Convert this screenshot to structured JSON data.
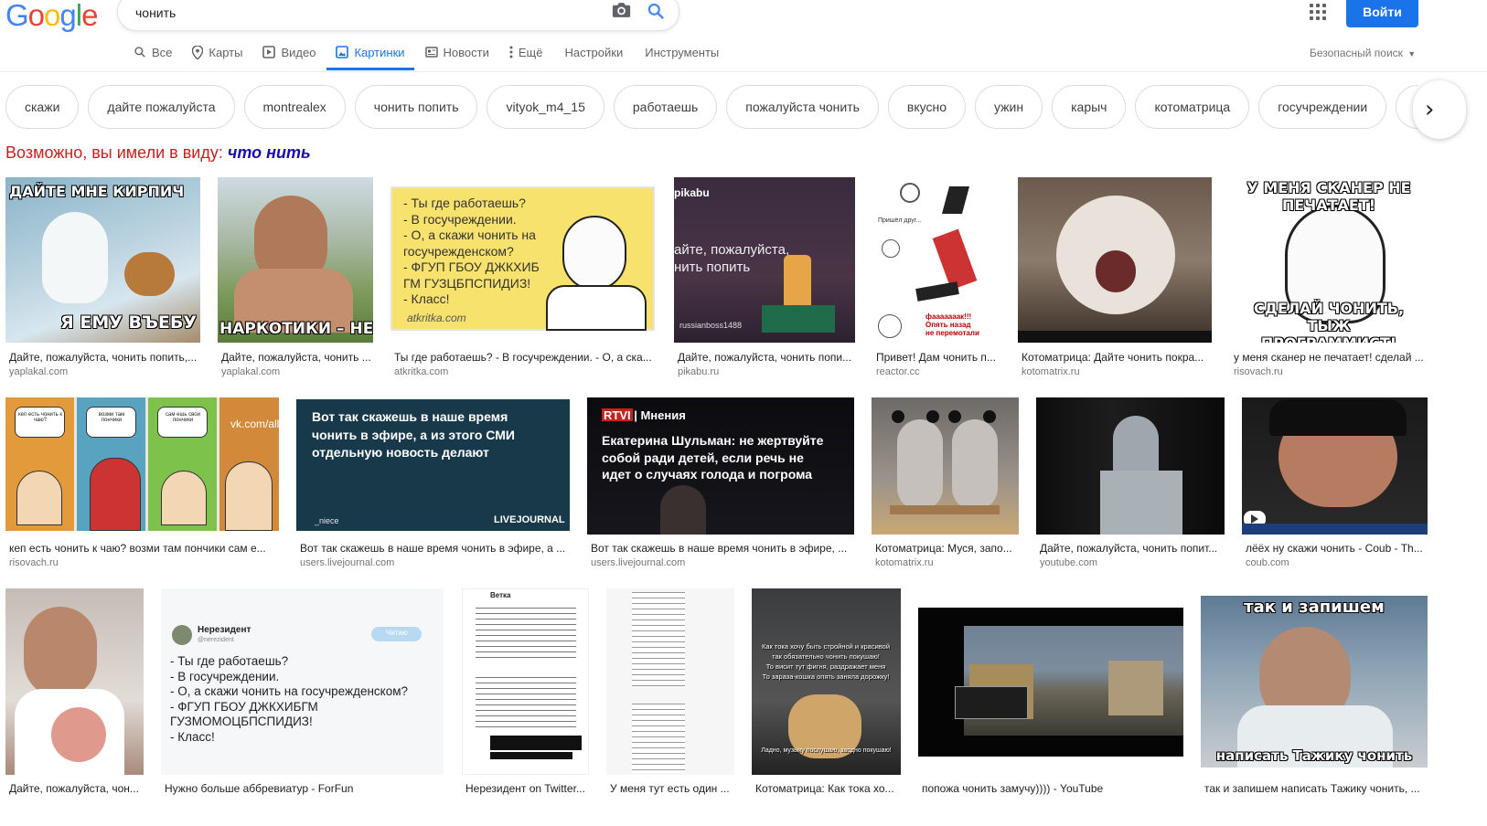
{
  "header": {
    "logo_letters": [
      "G",
      "o",
      "o",
      "g",
      "l",
      "e"
    ],
    "logo_colors": [
      "#4285f4",
      "#ea4335",
      "#fbbc05",
      "#4285f4",
      "#34a853",
      "#ea4335"
    ],
    "query": "чонить",
    "signin_label": "Войти"
  },
  "tabs": [
    {
      "label": "Все",
      "icon": "search-icon",
      "active": false
    },
    {
      "label": "Карты",
      "icon": "map-pin-icon",
      "active": false
    },
    {
      "label": "Видео",
      "icon": "video-icon",
      "active": false
    },
    {
      "label": "Картинки",
      "icon": "image-icon",
      "active": true
    },
    {
      "label": "Новости",
      "icon": "news-icon",
      "active": false
    },
    {
      "label": "Ещё",
      "icon": "more-vert-icon",
      "active": false
    }
  ],
  "tools": {
    "settings": "Настройки",
    "tools": "Инструменты"
  },
  "safe_search": "Безопасный поиск",
  "chips": [
    "скажи",
    "дайте пожалуйста",
    "montrealex",
    "чонить попить",
    "vityok_m4_15",
    "работаешь",
    "пожалуйста чонить",
    "вкусно",
    "ужин",
    "карыч",
    "котоматрица",
    "госучреждении",
    "скажешь"
  ],
  "did_you_mean": {
    "prefix": "Возможно, вы имели в виду:",
    "suggestion": "что нить"
  },
  "results": [
    {
      "caption": "Дайте, пожалуйста, чонить попить,...",
      "source": "yaplakal.com",
      "top_text": "ДАЙТЕ МНЕ КИРПИЧ",
      "bottom_text": "Я ЕМУ ВЪЕБУ"
    },
    {
      "caption": "Дайте, пожалуйста, чонить ...",
      "source": "yaplakal.com",
      "bottom_text": "НАРКОТИКИ – НЕ МОЯ Т"
    },
    {
      "caption": "Ты где работаешь? - В госучреждении. - О, а ска...",
      "source": "atkritka.com",
      "card_text": "- Ты где работаешь?\n- В госучреждении.\n- О, а скажи чонить на\nгосучрежденском?\n- ФГУП ГБОУ ДЖКХИБ\nГМ ГУЗЦБПСПИДИЗ!\n- Класс!",
      "brand": "atkritka.com"
    },
    {
      "caption": "Дайте, пожалуйста, чонить попи...",
      "source": "pikabu.ru",
      "header_text": "pikabu",
      "card_text": "айте, пожалуйста,\nнить попить",
      "footer_text": "russianboss1488"
    },
    {
      "caption": "Привет! Дам чонить п...",
      "source": "reactor.cc",
      "top_text": "Пришёл друг...",
      "bottom_text": "фааааааак!!!\nОпять назад\nне перемотали"
    },
    {
      "caption": "Котоматрица: Дайте чонить покра...",
      "source": "kotomatrix.ru"
    },
    {
      "caption": "у меня сканер не печатает! сделай ...",
      "source": "risovach.ru",
      "top_text": "У МЕНЯ СКАНЕР НЕ\nПЕЧАТАЕТ!",
      "bottom_text": "СДЕЛАЙ ЧОНИТЬ, ТЫЖ\nПРОГРАММИСТ!"
    },
    {
      "caption": "кеп есть чонить к чаю? возми там пончики сам е...",
      "source": "risovach.ru",
      "panel_texts": [
        "кеп есть чонить к чаю?",
        "возми там пончики",
        "сам ешь свои пончики"
      ],
      "brand": "vk.com/all"
    },
    {
      "caption": "Вот так скажешь в наше время чонить в эфире, а ...",
      "source": "users.livejournal.com",
      "card_text": "Вот так скажешь в наше время\nчонить в эфире, а из этого СМИ\nотдельную новость делают",
      "footer_text": "_niece",
      "brand": "LIVEJOURNAL"
    },
    {
      "caption": "Вот так скажешь в наше время чонить в эфире, ...",
      "source": "users.livejournal.com",
      "header_text": "RTVI | Мнения",
      "card_text": "Екатерина Шульман: не жертвуйте\nсобой ради детей, если речь не\nидет о случаях голода и погрома"
    },
    {
      "caption": "Котоматрица: Муся, запо...",
      "source": "kotomatrix.ru"
    },
    {
      "caption": "Дайте, пожалуйста, чонить попит...",
      "source": "youtube.com"
    },
    {
      "caption": "лёёх ну скажи чонить - Coub - Th...",
      "source": "coub.com"
    },
    {
      "caption": "Дайте, пожалуйста, чон...",
      "source": "yaplakal.com"
    },
    {
      "caption": "Нужно больше аббревиатур - ForFun",
      "source": "",
      "header_text": "Нерезидент",
      "handle": "@nerezident",
      "card_text": "- Ты где работаешь?\n- В госучреждении.\n- О, а скажи чонить на госучрежденском?\n- ФГУП ГБОУ ДЖКХИБГМ\nГУЗМОМОЦБПСПИДИЗ!\n- Класс!",
      "brand": "Читаю"
    },
    {
      "caption": "Нерезидент on Twitter...",
      "source": "",
      "header_text": "Ветка"
    },
    {
      "caption": "У меня тут есть один ...",
      "source": ""
    },
    {
      "caption": "Котоматрица: Как тока хо...",
      "source": "",
      "card_text": "Как тока хочу быть стройной и красивой\nтак обязательно чонить покушаю!\nТо висит тут фигня, раздражает меня\nТо зараза-кошка опять заняла дорожку!",
      "footer_text": "Ладно, музыку послушаю, заодно покушаю!"
    },
    {
      "caption": "попожа чонить замучу)))) - YouTube",
      "source": ""
    },
    {
      "caption": "так и запишем написать Тажику чонить, ...",
      "source": "",
      "top_text": "так и запишем",
      "bottom_text": "написать Тажику чонить"
    }
  ]
}
